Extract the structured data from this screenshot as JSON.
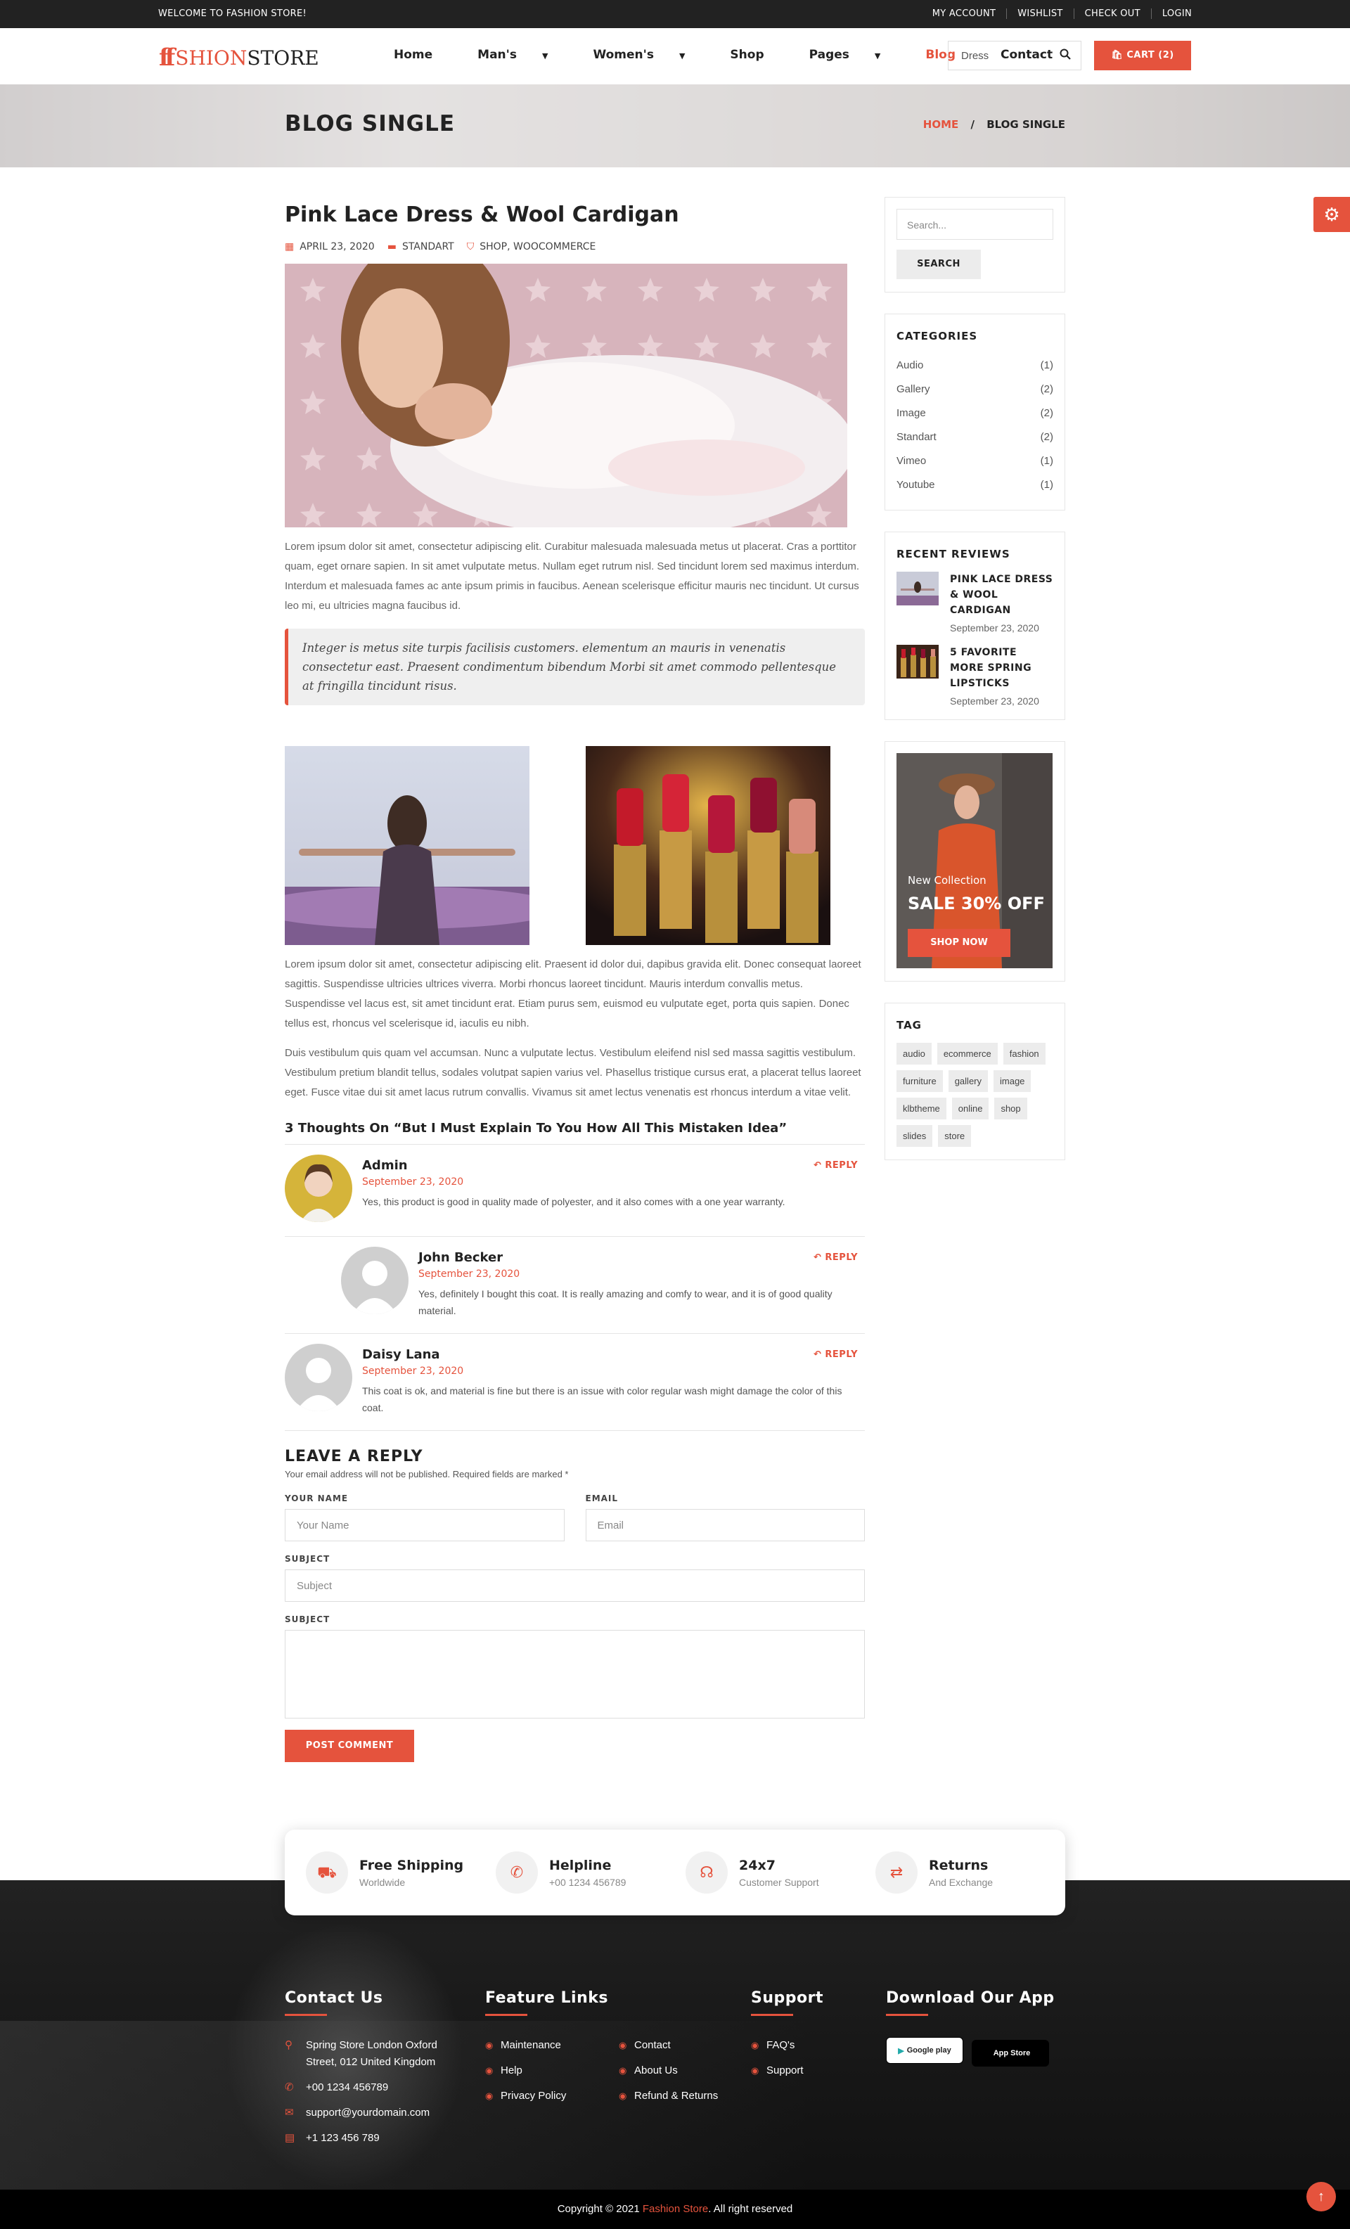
{
  "topbar": {
    "welcome": "WELCOME TO FASHION STORE!",
    "links": [
      "MY ACCOUNT",
      "WISHLIST",
      "CHECK OUT",
      "LOGIN"
    ]
  },
  "header": {
    "logo_ff": "ff",
    "logo_shion": "SHION",
    "logo_store": "STORE",
    "nav": [
      {
        "label": "Home",
        "dropdown": false,
        "active": false
      },
      {
        "label": "Man's",
        "dropdown": true,
        "active": false
      },
      {
        "label": "Women's",
        "dropdown": true,
        "active": false
      },
      {
        "label": "Shop",
        "dropdown": false,
        "active": false
      },
      {
        "label": "Pages",
        "dropdown": true,
        "active": false
      },
      {
        "label": "Blog",
        "dropdown": false,
        "active": true
      },
      {
        "label": "Contact",
        "dropdown": false,
        "active": false
      }
    ],
    "search_value": "Dress",
    "cart_label": "CART (2)"
  },
  "banner": {
    "title": "BLOG SINGLE",
    "crumb_home": "HOME",
    "crumb_sep": "/",
    "crumb_current": "BLOG SINGLE"
  },
  "post": {
    "title": "Pink Lace Dress & Wool Cardigan",
    "date": "APRIL 23, 2020",
    "category": "STANDART",
    "tags": "SHOP, WOOCOMMERCE",
    "para1": "Lorem ipsum dolor sit amet, consectetur adipiscing elit. Curabitur malesuada malesuada metus ut placerat. Cras a porttitor quam, eget ornare sapien. In sit amet vulputate metus. Nullam eget rutrum nisl. Sed tincidunt lorem sed maximus interdum. Interdum et malesuada fames ac ante ipsum primis in faucibus. Aenean scelerisque efficitur mauris nec tincidunt. Ut cursus leo mi, eu ultricies magna faucibus id.",
    "quote": "Integer is metus site turpis facilisis customers. elementum an mauris in venenatis consectetur east. Praesent condimentum bibendum Morbi sit amet commodo pellentesque at fringilla tincidunt risus.",
    "para2": "Lorem ipsum dolor sit amet, consectetur adipiscing elit. Praesent id dolor dui, dapibus gravida elit. Donec consequat laoreet sagittis. Suspendisse ultricies ultrices viverra. Morbi rhoncus laoreet tincidunt. Mauris interdum convallis metus. Suspendisse vel lacus est, sit amet tincidunt erat. Etiam purus sem, euismod eu vulputate eget, porta quis sapien. Donec tellus est, rhoncus vel scelerisque id, iaculis eu nibh.",
    "para3": "Duis vestibulum quis quam vel accumsan. Nunc a vulputate lectus. Vestibulum eleifend nisl sed massa sagittis vestibulum. Vestibulum pretium blandit tellus, sodales volutpat sapien varius vel. Phasellus tristique cursus erat, a placerat tellus laoreet eget. Fusce vitae dui sit amet lacus rutrum convallis. Vivamus sit amet lectus venenatis est rhoncus interdum a vitae velit."
  },
  "comments": {
    "title": "3 Thoughts On “But I Must Explain To You How All This Mistaken Idea”",
    "reply_label": "REPLY",
    "items": [
      {
        "name": "Admin",
        "date": "September 23, 2020",
        "text": "Yes, this product is good in quality made of polyester, and it also comes with a one year warranty."
      },
      {
        "name": "John Becker",
        "date": "September 23, 2020",
        "text": "Yes, definitely I bought this coat. It is really amazing and comfy to wear, and it is of good quality material."
      },
      {
        "name": "Daisy Lana",
        "date": "September 23, 2020",
        "text": "This coat is ok, and material is fine but there is an issue with color regular wash might damage the color of this coat."
      }
    ]
  },
  "reply_form": {
    "title": "LEAVE A REPLY",
    "note": "Your email address will not be published. Required fields are marked *",
    "name_label": "YOUR NAME",
    "name_placeholder": "Your Name",
    "email_label": "EMAIL",
    "email_placeholder": "Email",
    "subject_label": "SUBJECT",
    "subject_placeholder": "Subject",
    "message_label": "SUBJECT",
    "submit": "POST COMMENT"
  },
  "sidebar": {
    "search_placeholder": "Search...",
    "search_button": "SEARCH",
    "categories_title": "CATEGORIES",
    "categories": [
      {
        "name": "Audio",
        "count": "(1)"
      },
      {
        "name": "Gallery",
        "count": "(2)"
      },
      {
        "name": "Image",
        "count": "(2)"
      },
      {
        "name": "Standart",
        "count": "(2)"
      },
      {
        "name": "Vimeo",
        "count": "(1)"
      },
      {
        "name": "Youtube",
        "count": "(1)"
      }
    ],
    "reviews_title": "RECENT REVIEWS",
    "reviews": [
      {
        "name": "PINK LACE DRESS & WOOL CARDIGAN",
        "date": "September 23, 2020"
      },
      {
        "name": "5 FAVORITE MORE SPRING LIPSTICKS",
        "date": "September 23, 2020"
      }
    ],
    "promo_small": "New Collection",
    "promo_big": "SALE 30% OFF",
    "promo_button": "SHOP NOW",
    "tag_title": "TAG",
    "tags": [
      "audio",
      "ecommerce",
      "fashion",
      "furniture",
      "gallery",
      "image",
      "klbtheme",
      "online",
      "shop",
      "slides",
      "store"
    ]
  },
  "features": [
    {
      "icon": "truck-icon",
      "title": "Free Shipping",
      "sub": "Worldwide"
    },
    {
      "icon": "phone-icon",
      "title": "Helpline",
      "sub": "+00 1234 456789"
    },
    {
      "icon": "headset-icon",
      "title": "24x7",
      "sub": "Customer Support"
    },
    {
      "icon": "exchange-icon",
      "title": "Returns",
      "sub": "And Exchange"
    }
  ],
  "footer": {
    "contact_title": "Contact Us",
    "address": "Spring Store London Oxford Street, 012 United Kingdom",
    "phone": "+00 1234 456789",
    "email": "support@yourdomain.com",
    "fax": "+1 123 456 789",
    "feature_title": "Feature Links",
    "feature_links_a": [
      "Maintenance",
      "Help",
      "Privacy Policy"
    ],
    "feature_links_b": [
      "Contact",
      "About Us",
      "Refund & Returns"
    ],
    "support_title": "Support",
    "support_links": [
      "FAQ's",
      "Support"
    ],
    "app_title": "Download Our App",
    "google_play": "Google play",
    "app_store": "App Store",
    "copyright_pre": "Copyright © 2021 ",
    "copyright_brand": "Fashion Store",
    "copyright_post": ". All right reserved"
  },
  "colors": {
    "accent": "#e5533d",
    "dark": "#222222"
  }
}
